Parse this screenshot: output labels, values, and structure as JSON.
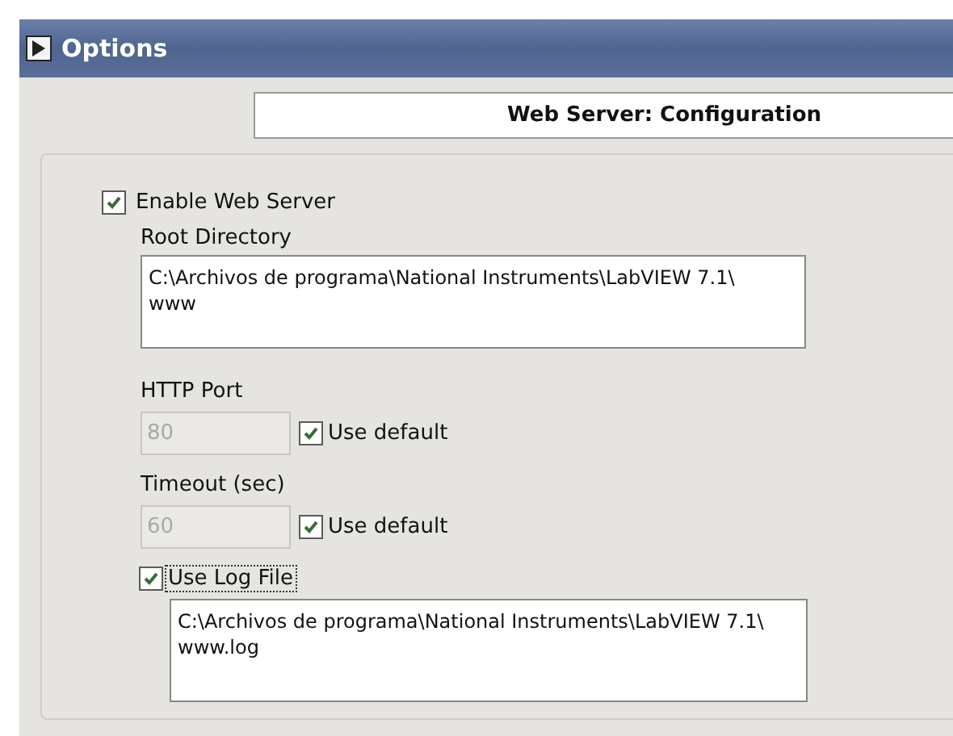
{
  "window": {
    "title": "Options"
  },
  "section_header": "Web Server: Configuration",
  "enable_web_server": {
    "label": "Enable Web Server",
    "checked": true
  },
  "root_directory": {
    "label": "Root Directory",
    "value": "C:\\Archivos de programa\\National Instruments\\LabVIEW 7.1\\\nwww"
  },
  "http_port": {
    "label": "HTTP Port",
    "value": "80",
    "disabled": true,
    "use_default": {
      "label": "Use default",
      "checked": true
    }
  },
  "timeout": {
    "label": "Timeout (sec)",
    "value": "60",
    "disabled": true,
    "use_default": {
      "label": "Use default",
      "checked": true
    }
  },
  "use_log_file": {
    "label": "Use Log File",
    "checked": true,
    "focused": true
  },
  "log_file": {
    "value": "C:\\Archivos de programa\\National Instruments\\LabVIEW 7.1\\\nwww.log"
  }
}
